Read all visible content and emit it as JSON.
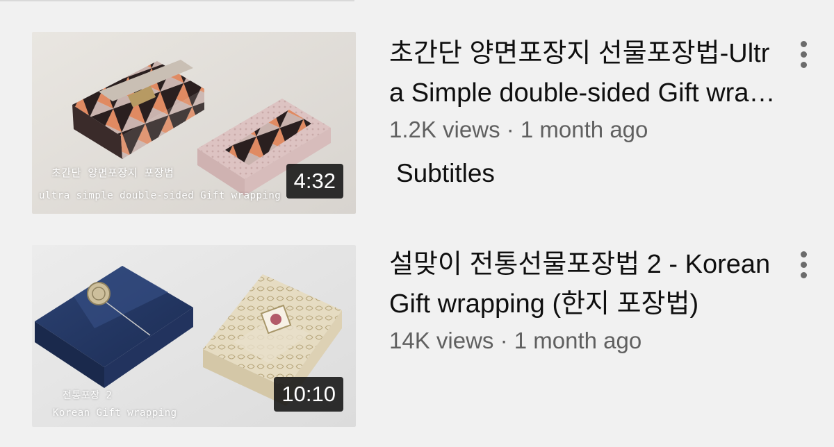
{
  "videos": [
    {
      "title": "초간단 양면포장지 선물포장법-Ultra Simple double-sided Gift wrapping",
      "views": "1.2K views",
      "separator": " · ",
      "age": "1 month ago",
      "duration": "4:32",
      "badge": "Subtitles",
      "thumbnail_caption_line1": "초간단 양면포장지 포장법",
      "thumbnail_caption_line2": "ultra simple double-sided Gift wrapping"
    },
    {
      "title": "설맞이 전통선물포장법 2 - Korean Gift wrapping (한지 포장법)",
      "views": "14K views",
      "separator": " · ",
      "age": "1 month ago",
      "duration": "10:10",
      "thumbnail_caption_line1": "전통포장 2",
      "thumbnail_caption_line2": "Korean Gift wrapping"
    }
  ],
  "icons": {
    "more": "more-vert-icon"
  },
  "colors": {
    "background": "#f1f1f1",
    "title": "#0f0f0f",
    "secondary": "#606060",
    "duration_bg": "#0f0f0f"
  }
}
